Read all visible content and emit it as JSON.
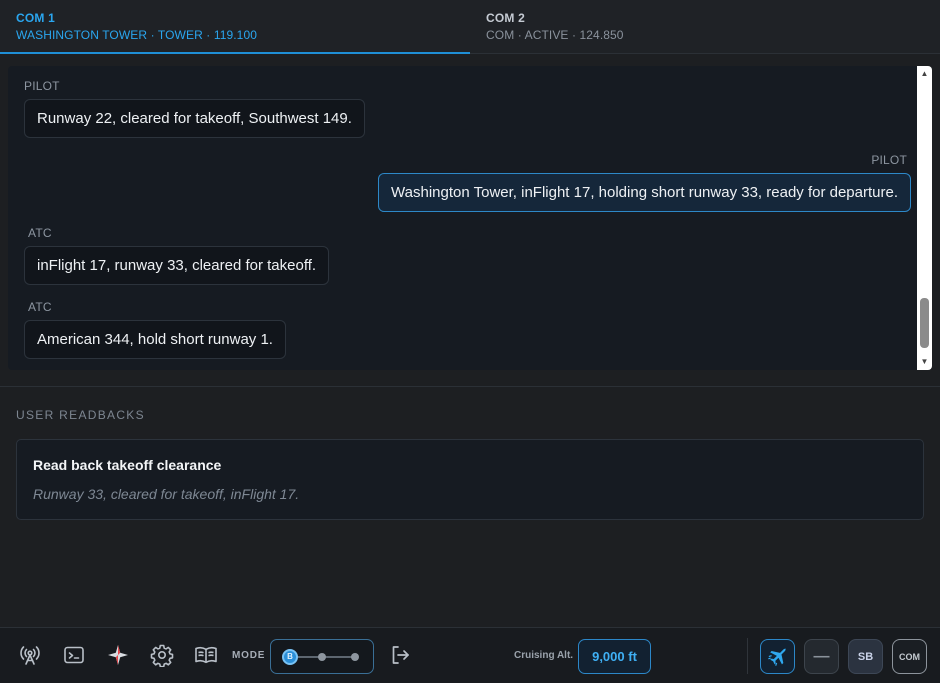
{
  "tabs": [
    {
      "name": "COM 1",
      "sub": "WASHINGTON TOWER · TOWER · 119.100",
      "active": true
    },
    {
      "name": "COM 2",
      "sub": "COM · ACTIVE · 124.850",
      "active": false
    }
  ],
  "transcript": [
    {
      "speaker": "PILOT",
      "text": "Runway 22, cleared for takeoff, Southwest 149.",
      "side": "left"
    },
    {
      "speaker": "PILOT",
      "text": "Washington Tower, inFlight 17, holding short runway 33, ready for departure.",
      "side": "right"
    },
    {
      "speaker": "ATC",
      "text": "inFlight 17, runway 33, cleared for takeoff.",
      "side": "left"
    },
    {
      "speaker": "ATC",
      "text": "American 344, hold short runway 1.",
      "side": "left"
    }
  ],
  "readbacks": {
    "title": "USER READBACKS",
    "items": [
      {
        "heading": "Read back takeoff clearance",
        "text": "Runway 33, cleared for takeoff, inFlight 17."
      }
    ]
  },
  "bottombar": {
    "icons": [
      "antenna-icon",
      "terminal-icon",
      "compass-icon",
      "gear-icon",
      "book-icon"
    ],
    "mode_label": "MODE",
    "mode_knob": "B",
    "logout_icon": "logout-icon",
    "cruise_label": "Cruising Alt.",
    "cruise_value": "9,000 ft",
    "minus_label": "—",
    "sb_label": "SB",
    "com_label": "COM"
  },
  "colors": {
    "accent": "#2aa6ef",
    "background": "#1d1f22",
    "panel": "#161b22"
  }
}
